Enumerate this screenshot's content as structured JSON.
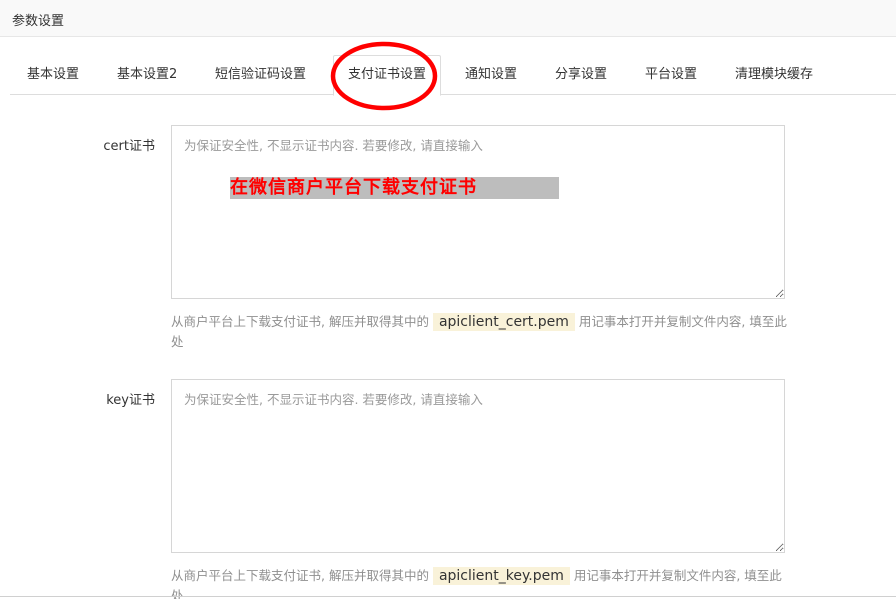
{
  "header": {
    "title": "参数设置"
  },
  "tabs": [
    {
      "label": "基本设置"
    },
    {
      "label": "基本设置2"
    },
    {
      "label": "短信验证码设置"
    },
    {
      "label": "支付证书设置"
    },
    {
      "label": "通知设置"
    },
    {
      "label": "分享设置"
    },
    {
      "label": "平台设置"
    },
    {
      "label": "清理模块缓存"
    }
  ],
  "active_tab": "支付证书设置",
  "annotation": {
    "text": "在微信商户平台下载支付证书",
    "text_color": "#ff0000",
    "circle_color": "#ff0000"
  },
  "fields": {
    "cert": {
      "label": "cert证书",
      "placeholder": "为保证安全性, 不显示证书内容. 若要修改, 请直接输入",
      "value": "",
      "help_prefix": "从商户平台上下载支付证书, 解压并取得其中的",
      "help_code": "apiclient_cert.pem",
      "help_suffix": "用记事本打开并复制文件内容, 填至此处"
    },
    "key": {
      "label": "key证书",
      "placeholder": "为保证安全性, 不显示证书内容. 若要修改, 请直接输入",
      "value": "",
      "help_prefix": "从商户平台上下载支付证书, 解压并取得其中的",
      "help_code": "apiclient_key.pem",
      "help_suffix": "用记事本打开并复制文件内容, 填至此处"
    }
  }
}
